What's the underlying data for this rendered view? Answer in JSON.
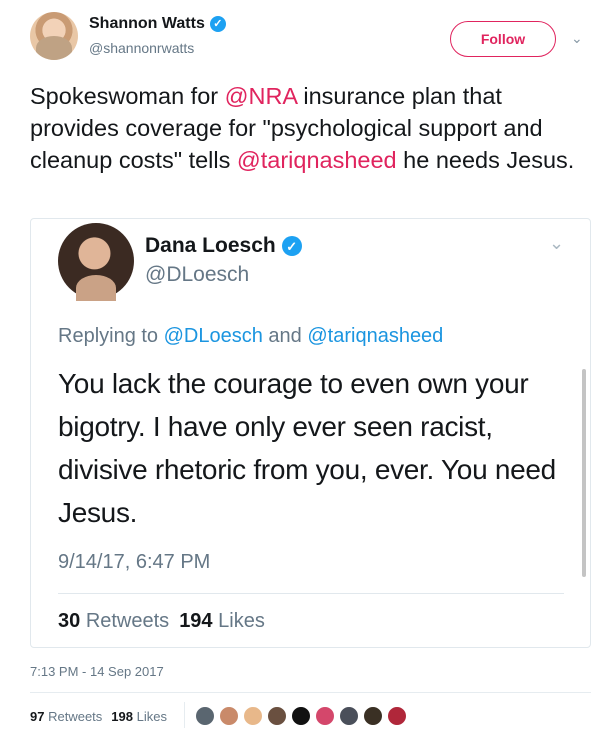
{
  "header": {
    "name": "Shannon Watts",
    "handle": "@shannonrwatts",
    "follow_label": "Follow",
    "caret": "⌄"
  },
  "tweet": {
    "text_before": "Spokeswoman for ",
    "mention_nra": "@NRA",
    "text_middle": " insurance plan that provides coverage for \"psychological support and cleanup costs\" tells ",
    "mention_tariq": "@tariqnasheed",
    "text_after": " he needs Jesus."
  },
  "quoted": {
    "name": "Dana Loesch",
    "handle": "@DLoesch",
    "caret": "⌄",
    "replying_prefix": "Replying to ",
    "replying_user1": "@DLoesch",
    "replying_and": " and ",
    "replying_user2": "@tariqnasheed",
    "body": "You lack the courage to even own your bigotry. I have only ever seen racist, divisive rhetoric from you, ever. You need Jesus.",
    "date": "9/14/17, 6:47 PM",
    "retweets_count": "30",
    "retweets_label": "Retweets",
    "likes_count": "194",
    "likes_label": "Likes"
  },
  "footer": {
    "timestamp": "7:13 PM - 14 Sep 2017",
    "retweets_count": "97",
    "retweets_label": "Retweets",
    "likes_count": "198",
    "likes_label": "Likes"
  },
  "colors": {
    "accent": "#e0245e",
    "link": "#1b95e0",
    "verified": "#1da1f2",
    "muted": "#657786"
  },
  "likers": [
    {
      "icon": "liker-avatar",
      "color": "#5a6670"
    },
    {
      "icon": "liker-avatar",
      "color": "#c98a6a"
    },
    {
      "icon": "liker-avatar",
      "color": "#e8b88a"
    },
    {
      "icon": "liker-avatar",
      "color": "#6a5040"
    },
    {
      "icon": "liker-avatar",
      "color": "#111111"
    },
    {
      "icon": "liker-avatar",
      "color": "#d4476b"
    },
    {
      "icon": "liker-avatar",
      "color": "#4a4f5a"
    },
    {
      "icon": "liker-avatar",
      "color": "#3a3024"
    },
    {
      "icon": "liker-avatar",
      "color": "#b0273a"
    }
  ]
}
